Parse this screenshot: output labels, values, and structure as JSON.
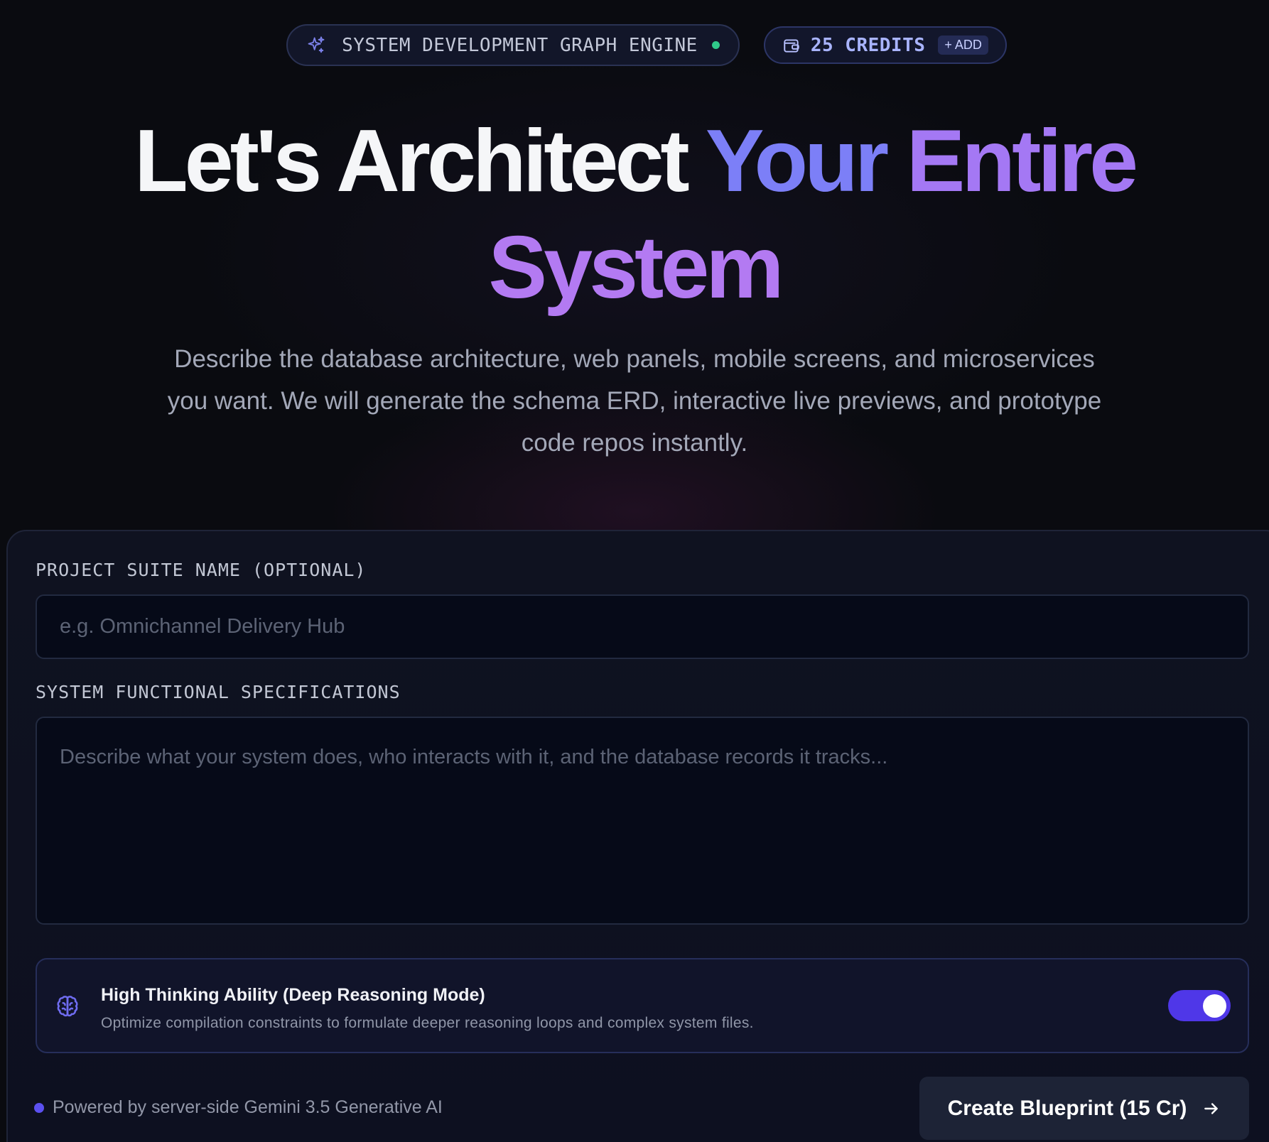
{
  "header": {
    "engine_badge": {
      "label": "SYSTEM DEVELOPMENT GRAPH ENGINE",
      "icon": "sparkles-icon",
      "status": "online",
      "status_color": "#2fc98a"
    },
    "credits_badge": {
      "label": "25 CREDITS",
      "add_label": "+ ADD",
      "icon": "wallet-icon"
    }
  },
  "hero": {
    "line1_plain": "Let's Architect ",
    "line1_accent_a": "Your ",
    "line1_accent_b": "Entire",
    "line2_accent": "System",
    "subtitle": "Describe the database architecture, web panels, mobile screens, and microservices you want. We will generate the schema ERD, interactive live previews, and prototype code repos instantly."
  },
  "form": {
    "project_name": {
      "label": "PROJECT SUITE NAME (OPTIONAL)",
      "value": "",
      "placeholder": "e.g. Omnichannel Delivery Hub"
    },
    "specifications": {
      "label": "SYSTEM FUNCTIONAL SPECIFICATIONS",
      "value": "",
      "placeholder": "Describe what your system does, who interacts with it, and the database records it tracks..."
    },
    "deep_reasoning": {
      "icon": "brain-icon",
      "title": "High Thinking Ability (Deep Reasoning Mode)",
      "description": "Optimize compilation constraints to formulate deeper reasoning loops and complex system files.",
      "enabled": true
    }
  },
  "footer": {
    "powered_by": "Powered by server-side Gemini 3.5 Generative AI",
    "submit_label": "Create Blueprint (15 Cr)",
    "submit_icon": "arrow-right-icon"
  },
  "colors": {
    "background": "#0a0b10",
    "accent_indigo": "#7c7ff7",
    "accent_purple": "#b37af2",
    "toggle_on": "#4f37e8",
    "credits_text": "#a9b4ff"
  }
}
